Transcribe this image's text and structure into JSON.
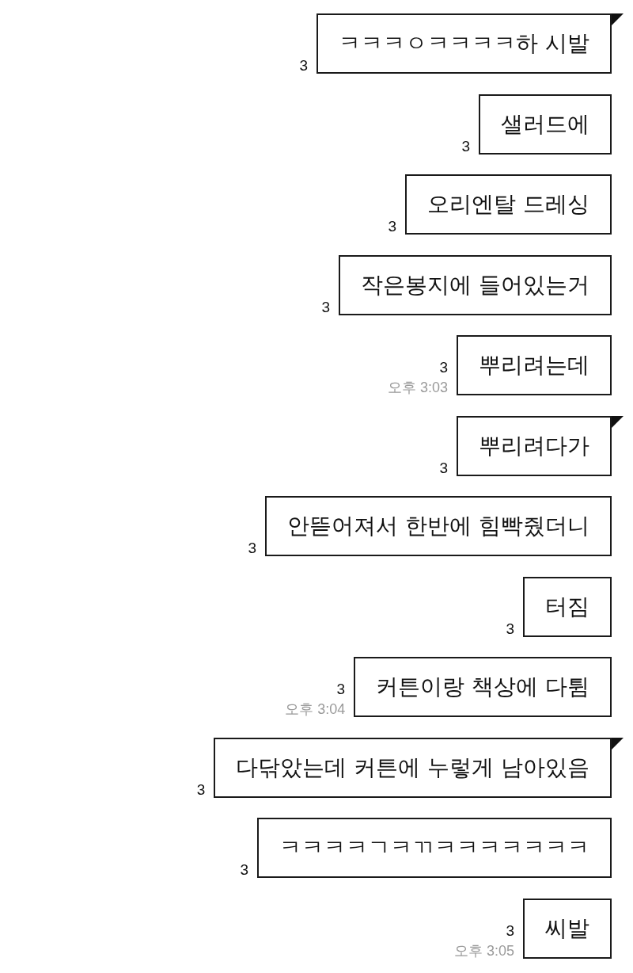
{
  "messages": [
    {
      "text": "ㅋㅋㅋㅇㅋㅋㅋㅋ하 시발",
      "tail": true,
      "unread": "3"
    },
    {
      "text": "샐러드에",
      "tail": false,
      "unread": "3"
    },
    {
      "text": "오리엔탈 드레싱",
      "tail": false,
      "unread": "3"
    },
    {
      "text": "작은봉지에 들어있는거",
      "tail": false,
      "unread": "3"
    },
    {
      "text": "뿌리려는데",
      "tail": false,
      "unread": "3",
      "time": "오후 3:03"
    },
    {
      "text": "뿌리려다가",
      "tail": true,
      "unread": "3"
    },
    {
      "text": "안뜯어져서 한반에 힘빡줬더니",
      "tail": false,
      "unread": "3"
    },
    {
      "text": "터짐",
      "tail": false,
      "unread": "3"
    },
    {
      "text": "커튼이랑 책상에 다튐",
      "tail": false,
      "unread": "3",
      "time": "오후 3:04"
    },
    {
      "text": "다닦았는데 커튼에 누렇게 남아있음",
      "tail": true,
      "unread": "3"
    },
    {
      "text": "ㅋㅋㅋㅋㄱㅋㄲㅋㅋㅋㅋㅋㅋㅋ",
      "tail": false,
      "unread": "3"
    },
    {
      "text": "씨발",
      "tail": false,
      "unread": "3",
      "time": "오후 3:05"
    }
  ]
}
